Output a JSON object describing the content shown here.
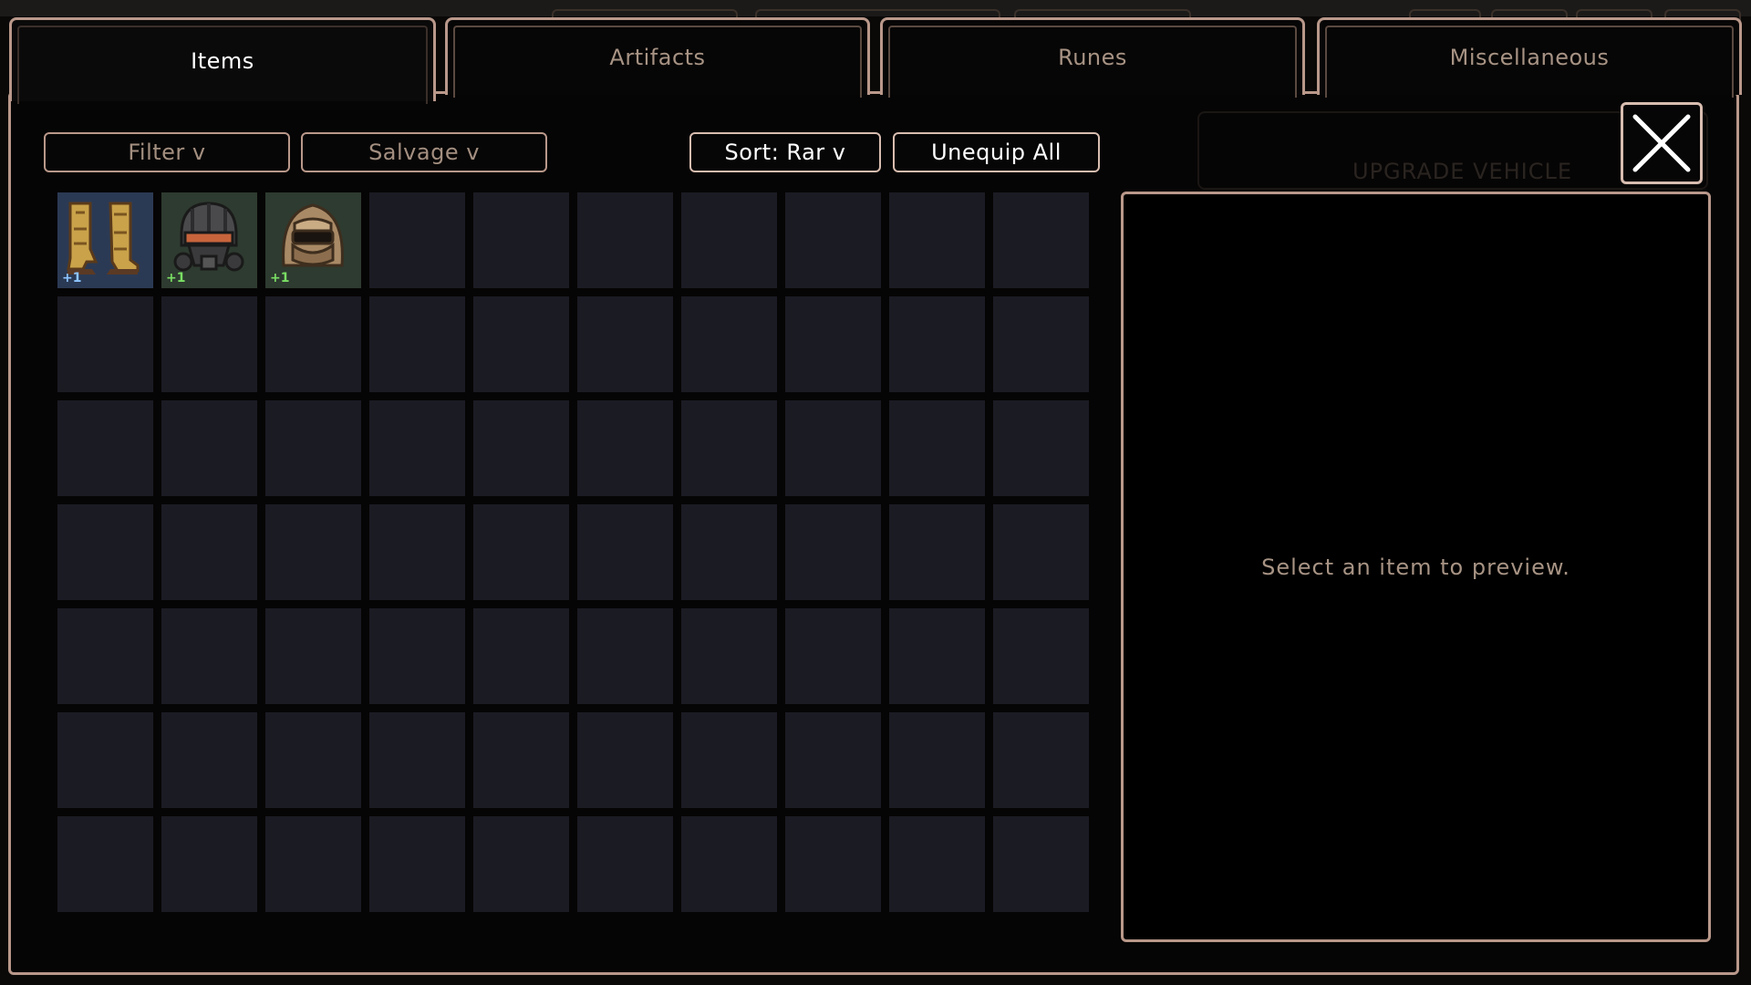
{
  "tabs": [
    {
      "label": "Items",
      "active": true
    },
    {
      "label": "Artifacts",
      "active": false
    },
    {
      "label": "Runes",
      "active": false
    },
    {
      "label": "Miscellaneous",
      "active": false
    }
  ],
  "toolbar": {
    "filter_label": "Filter v",
    "salvage_label": "Salvage v",
    "sort_label": "Sort: Rar v",
    "unequip_label": "Unequip All"
  },
  "inventory": {
    "total_slots": 70,
    "items": [
      {
        "icon": "golden-boots-icon",
        "rarity": "rare",
        "level": "+1"
      },
      {
        "icon": "gas-mask-helmet-icon",
        "rarity": "uncommon",
        "level": "+1"
      },
      {
        "icon": "hooded-mask-icon",
        "rarity": "uncommon",
        "level": "+1"
      }
    ]
  },
  "preview": {
    "empty_text": "Select an item to preview."
  },
  "background": {
    "upgrade_label": "UPGRADE VEHICLE"
  },
  "colors": {
    "border": "#b9988a",
    "slot_empty": "#1b1b24",
    "slot_rare": "#2b3a54",
    "slot_uncommon": "#2e3b30",
    "level_badge": "#7adf64"
  },
  "close_icon": "close-icon"
}
